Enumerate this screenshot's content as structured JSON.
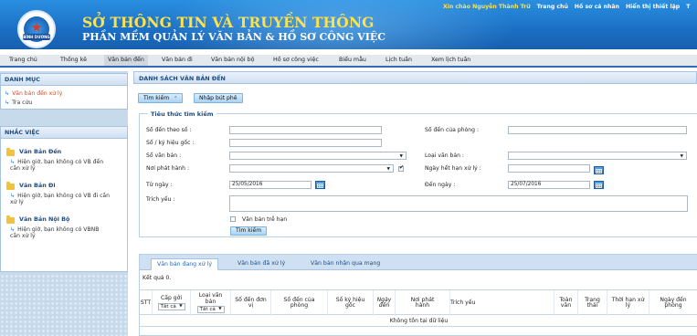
{
  "header": {
    "title": "SỞ THÔNG TIN VÀ TRUYỀN THÔNG",
    "subtitle": "PHẦN MỀM QUẢN LÝ VĂN BẢN & HỒ SƠ CÔNG VIỆC",
    "logo_text": "BÌNH DƯƠNG",
    "greeting": "Xin chào Nguyễn Thành Trữ",
    "links": [
      "Trang chủ",
      "Hồ sơ cá nhân",
      "Hiển thị thiết lập",
      "T"
    ]
  },
  "menu": {
    "items": [
      "Trang chủ",
      "Thống kê",
      "Văn bản đến",
      "Văn bản đi",
      "Văn bản nội bộ",
      "Hồ sơ công việc",
      "Biểu mẫu",
      "Lịch tuần",
      "Xem lịch tuần"
    ],
    "active_index": 2
  },
  "sidebar": {
    "danh_muc": {
      "title": "DANH MỤC",
      "items": [
        "Văn bản đến xử lý",
        "Tra cứu"
      ]
    },
    "nhac_viec": {
      "title": "NHẮC VIỆC",
      "groups": [
        {
          "title": "Văn Bản Đến",
          "text": "Hiện giờ, bạn không có VB đến cần xử lý"
        },
        {
          "title": "Văn Bản Đi",
          "text": "Hiện giờ, bạn không có VB đi cần xử lý"
        },
        {
          "title": "Văn Bản Nội Bộ",
          "text": "Hiện giờ, bạn không có VBNB cần xử lý"
        }
      ]
    }
  },
  "main": {
    "title": "DANH SÁCH VĂN BẢN ĐẾN",
    "buttons": {
      "search_toggle": "Tìm kiếm",
      "nhap_but_phe": "Nhập bút phê"
    },
    "search": {
      "legend": "Tiêu thức tìm kiếm",
      "labels": {
        "so_den_theo_so": "Số đến theo số :",
        "so_ky_hieu_goc": "Số / ký hiệu gốc :",
        "so_van_ban": "Sổ văn bản :",
        "noi_phat_hanh": "Nơi phát hành :",
        "tu_ngay": "Từ ngày :",
        "trich_yeu": "Trích yếu :",
        "so_den_cua_phong": "Số đến của phòng :",
        "loai_van_ban": "Loại văn bản :",
        "ngay_het_han": "Ngày hết hạn xử lý :",
        "den_ngay": "Đến ngày :",
        "van_ban_tre_han": "Văn bản trễ hạn"
      },
      "values": {
        "so_den_theo_so": "",
        "so_ky_hieu_goc": "",
        "so_van_ban": "",
        "noi_phat_hanh": "",
        "tu_ngay": "25/05/2016",
        "trich_yeu": "",
        "so_den_cua_phong": "",
        "loai_van_ban": "",
        "ngay_het_han": "",
        "den_ngay": "25/07/2016"
      },
      "submit": "Tìm kiếm"
    },
    "tabs": [
      "Văn bản đang xử lý",
      "Văn bản đã xử lý",
      "Văn bản nhận qua mạng"
    ],
    "active_tab": 0,
    "result_text": "Kết quả 0.",
    "table": {
      "columns": [
        "STT",
        "Cấp gởi",
        "Loại văn bản",
        "Số đến đơn vị",
        "Số đến của phòng",
        "Số ký hiệu gốc",
        "Ngày đến",
        "Nơi phát hành",
        "Trích yếu",
        "Toàn văn",
        "Trạng thái",
        "Thời hạn xử lý",
        "Ngày đến phòng"
      ],
      "filter_value": "Tất cả",
      "empty_text": "Không tồn tại dữ liệu"
    }
  }
}
